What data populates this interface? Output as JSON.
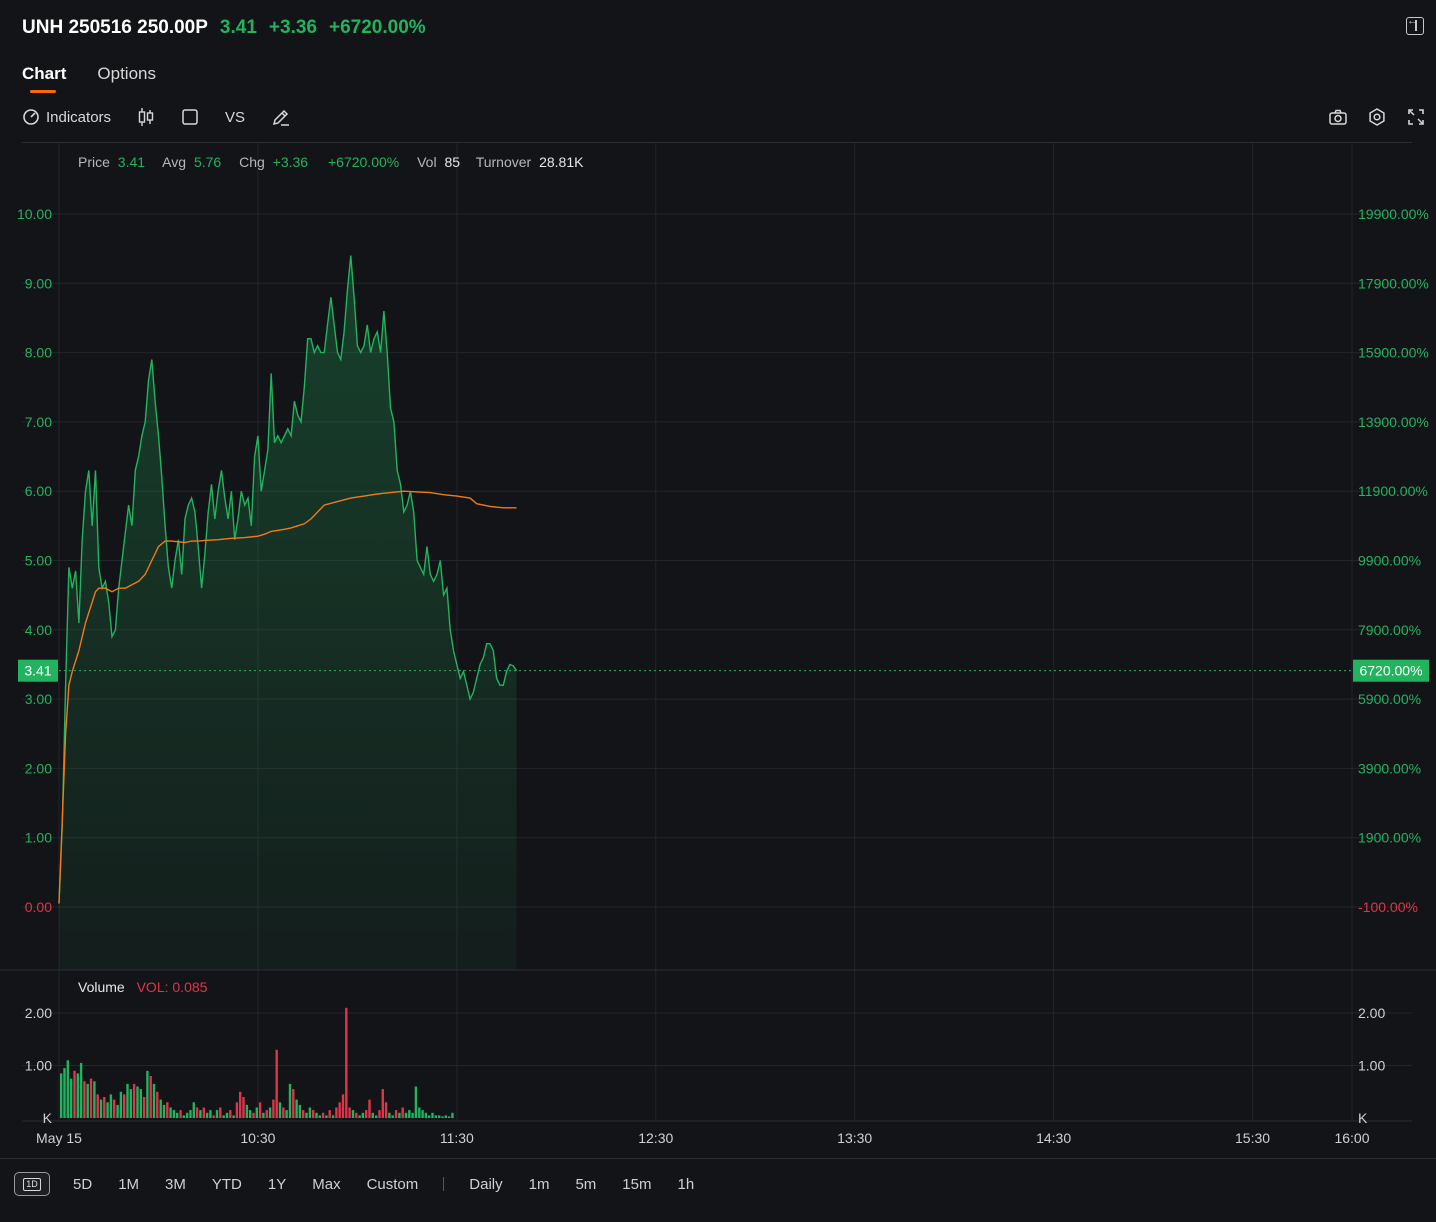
{
  "header": {
    "symbol": "UNH 250516 250.00P",
    "price": "3.41",
    "change": "+3.36",
    "change_pct": "+6720.00%"
  },
  "tabs": [
    {
      "label": "Chart",
      "active": true
    },
    {
      "label": "Options",
      "active": false
    }
  ],
  "toolbar": {
    "indicators_label": "Indicators",
    "vs_label": "VS"
  },
  "info_bar": {
    "price_label": "Price",
    "price_value": "3.41",
    "avg_label": "Avg",
    "avg_value": "5.76",
    "chg_label": "Chg",
    "chg_value": "+3.36",
    "chg_pct_value": "+6720.00%",
    "vol_label": "Vol",
    "vol_value": "85",
    "turnover_label": "Turnover",
    "turnover_value": "28.81K"
  },
  "volume_legend": {
    "label": "Volume",
    "value": "VOL: 0.085"
  },
  "periods": {
    "day": "1D",
    "ranges": [
      "5D",
      "1M",
      "3M",
      "YTD",
      "1Y",
      "Max",
      "Custom"
    ],
    "intervals": [
      "Daily",
      "1m",
      "5m",
      "15m",
      "1h"
    ]
  },
  "colors": {
    "up": "#22b35e",
    "down": "#e0344a",
    "avg_line": "#f07a1a",
    "background": "#131418"
  },
  "chart_data": {
    "type": "line",
    "x_ticks": [
      "May 15",
      "10:30",
      "11:30",
      "12:30",
      "13:30",
      "14:30",
      "15:30",
      "16:00"
    ],
    "x_tick_minutes": [
      0,
      60,
      120,
      180,
      240,
      300,
      360,
      390
    ],
    "xlim": [
      0,
      390
    ],
    "ylim": [
      0,
      10
    ],
    "y_ticks": [
      "10.00",
      "9.00",
      "8.00",
      "7.00",
      "6.00",
      "5.00",
      "4.00",
      "3.00",
      "2.00",
      "1.00",
      "0.00"
    ],
    "y_right_ticks": [
      "19900.00%",
      "17900.00%",
      "15900.00%",
      "13900.00%",
      "11900.00%",
      "9900.00%",
      "7900.00%",
      "5900.00%",
      "3900.00%",
      "1900.00%",
      "-100.00%"
    ],
    "last_price_label": "3.41",
    "last_pct_label": "6720.00%",
    "last_price": 3.41,
    "grid": true,
    "series": [
      {
        "values": [
          [
            0,
            0.05
          ],
          [
            1,
            1.2
          ],
          [
            2,
            3.2
          ],
          [
            3,
            4.9
          ],
          [
            4,
            4.6
          ],
          [
            5,
            4.85
          ],
          [
            6,
            4.1
          ],
          [
            7,
            5.3
          ],
          [
            8,
            6.0
          ],
          [
            9,
            6.3
          ],
          [
            10,
            5.5
          ],
          [
            11,
            6.3
          ],
          [
            12,
            4.9
          ],
          [
            13,
            4.6
          ],
          [
            14,
            4.7
          ],
          [
            15,
            4.4
          ],
          [
            16,
            3.9
          ],
          [
            17,
            4.0
          ],
          [
            18,
            4.6
          ],
          [
            19,
            5.0
          ],
          [
            20,
            5.4
          ],
          [
            21,
            5.8
          ],
          [
            22,
            5.5
          ],
          [
            23,
            6.3
          ],
          [
            24,
            6.5
          ],
          [
            25,
            6.8
          ],
          [
            26,
            7.0
          ],
          [
            27,
            7.6
          ],
          [
            28,
            7.9
          ],
          [
            29,
            7.3
          ],
          [
            30,
            6.8
          ],
          [
            31,
            6.2
          ],
          [
            32,
            5.5
          ],
          [
            33,
            4.9
          ],
          [
            34,
            4.6
          ],
          [
            35,
            5.0
          ],
          [
            36,
            5.3
          ],
          [
            37,
            4.8
          ],
          [
            38,
            5.6
          ],
          [
            39,
            5.8
          ],
          [
            40,
            5.9
          ],
          [
            41,
            5.7
          ],
          [
            42,
            5.2
          ],
          [
            43,
            4.6
          ],
          [
            44,
            5.1
          ],
          [
            45,
            5.7
          ],
          [
            46,
            6.1
          ],
          [
            47,
            5.6
          ],
          [
            48,
            6.0
          ],
          [
            49,
            6.3
          ],
          [
            50,
            5.9
          ],
          [
            51,
            5.6
          ],
          [
            52,
            6.0
          ],
          [
            53,
            5.3
          ],
          [
            54,
            5.6
          ],
          [
            55,
            6.0
          ],
          [
            56,
            5.8
          ],
          [
            57,
            5.9
          ],
          [
            58,
            5.5
          ],
          [
            59,
            6.5
          ],
          [
            60,
            6.8
          ],
          [
            61,
            6.0
          ],
          [
            62,
            6.3
          ],
          [
            63,
            6.6
          ],
          [
            64,
            7.7
          ],
          [
            65,
            6.7
          ],
          [
            66,
            6.8
          ],
          [
            67,
            6.7
          ],
          [
            68,
            6.8
          ],
          [
            69,
            6.9
          ],
          [
            70,
            6.8
          ],
          [
            71,
            7.3
          ],
          [
            72,
            7.1
          ],
          [
            73,
            7.0
          ],
          [
            74,
            7.5
          ],
          [
            75,
            8.2
          ],
          [
            76,
            8.2
          ],
          [
            77,
            8.0
          ],
          [
            78,
            8.1
          ],
          [
            79,
            8.0
          ],
          [
            80,
            8.0
          ],
          [
            81,
            8.4
          ],
          [
            82,
            8.8
          ],
          [
            83,
            8.4
          ],
          [
            84,
            8.0
          ],
          [
            85,
            7.9
          ],
          [
            86,
            8.3
          ],
          [
            87,
            8.9
          ],
          [
            88,
            9.4
          ],
          [
            89,
            8.8
          ],
          [
            90,
            8.1
          ],
          [
            91,
            8.0
          ],
          [
            92,
            8.1
          ],
          [
            93,
            8.4
          ],
          [
            94,
            8.0
          ],
          [
            95,
            8.2
          ],
          [
            96,
            8.3
          ],
          [
            97,
            8.0
          ],
          [
            98,
            8.6
          ],
          [
            99,
            8.0
          ],
          [
            100,
            7.2
          ],
          [
            101,
            7.0
          ],
          [
            102,
            6.3
          ],
          [
            103,
            6.1
          ],
          [
            104,
            5.7
          ],
          [
            105,
            5.8
          ],
          [
            106,
            6.0
          ],
          [
            107,
            5.7
          ],
          [
            108,
            5.0
          ],
          [
            109,
            4.9
          ],
          [
            110,
            4.8
          ],
          [
            111,
            5.2
          ],
          [
            112,
            4.8
          ],
          [
            113,
            4.7
          ],
          [
            114,
            4.8
          ],
          [
            115,
            5.0
          ],
          [
            116,
            4.5
          ],
          [
            117,
            4.6
          ],
          [
            118,
            4.0
          ],
          [
            119,
            3.7
          ],
          [
            120,
            3.5
          ],
          [
            121,
            3.3
          ],
          [
            122,
            3.4
          ],
          [
            123,
            3.2
          ],
          [
            124,
            3.0
          ],
          [
            125,
            3.1
          ],
          [
            126,
            3.3
          ],
          [
            127,
            3.5
          ],
          [
            128,
            3.6
          ],
          [
            129,
            3.8
          ],
          [
            130,
            3.8
          ],
          [
            131,
            3.7
          ],
          [
            132,
            3.3
          ],
          [
            133,
            3.2
          ],
          [
            134,
            3.2
          ],
          [
            135,
            3.4
          ],
          [
            136,
            3.5
          ],
          [
            137,
            3.48
          ],
          [
            138,
            3.41
          ]
        ]
      },
      {
        "values": [
          [
            0,
            0.05
          ],
          [
            2,
            2.5
          ],
          [
            3,
            3.2
          ],
          [
            4,
            3.4
          ],
          [
            6,
            3.7
          ],
          [
            8,
            4.1
          ],
          [
            10,
            4.4
          ],
          [
            11,
            4.55
          ],
          [
            12,
            4.6
          ],
          [
            14,
            4.6
          ],
          [
            16,
            4.55
          ],
          [
            18,
            4.6
          ],
          [
            20,
            4.6
          ],
          [
            22,
            4.65
          ],
          [
            24,
            4.7
          ],
          [
            26,
            4.8
          ],
          [
            28,
            5.0
          ],
          [
            30,
            5.2
          ],
          [
            32,
            5.28
          ],
          [
            34,
            5.28
          ],
          [
            36,
            5.27
          ],
          [
            38,
            5.26
          ],
          [
            40,
            5.28
          ],
          [
            42,
            5.28
          ],
          [
            44,
            5.29
          ],
          [
            48,
            5.3
          ],
          [
            52,
            5.32
          ],
          [
            56,
            5.33
          ],
          [
            60,
            5.35
          ],
          [
            62,
            5.38
          ],
          [
            64,
            5.42
          ],
          [
            68,
            5.45
          ],
          [
            70,
            5.47
          ],
          [
            72,
            5.5
          ],
          [
            74,
            5.53
          ],
          [
            76,
            5.6
          ],
          [
            78,
            5.7
          ],
          [
            80,
            5.8
          ],
          [
            84,
            5.85
          ],
          [
            88,
            5.9
          ],
          [
            92,
            5.93
          ],
          [
            96,
            5.96
          ],
          [
            100,
            5.98
          ],
          [
            104,
            6.0
          ],
          [
            108,
            5.99
          ],
          [
            112,
            5.98
          ],
          [
            116,
            5.95
          ],
          [
            120,
            5.93
          ],
          [
            124,
            5.9
          ],
          [
            126,
            5.82
          ],
          [
            130,
            5.78
          ],
          [
            134,
            5.76
          ],
          [
            138,
            5.76
          ]
        ]
      }
    ]
  },
  "volume_chart": {
    "type": "bar",
    "y_ticks": [
      "2.00",
      "1.00",
      "K"
    ],
    "y_right_ticks": [
      "2.00",
      "1.00",
      "K"
    ],
    "ylim": [
      0,
      2.2
    ],
    "bars": [
      [
        0.85,
        "up"
      ],
      [
        0.95,
        "up"
      ],
      [
        1.1,
        "up"
      ],
      [
        0.75,
        "up"
      ],
      [
        0.9,
        "down"
      ],
      [
        0.85,
        "up"
      ],
      [
        1.05,
        "up"
      ],
      [
        0.7,
        "down"
      ],
      [
        0.65,
        "up"
      ],
      [
        0.75,
        "down"
      ],
      [
        0.7,
        "up"
      ],
      [
        0.45,
        "down"
      ],
      [
        0.35,
        "up"
      ],
      [
        0.4,
        "down"
      ],
      [
        0.3,
        "up"
      ],
      [
        0.45,
        "up"
      ],
      [
        0.35,
        "down"
      ],
      [
        0.25,
        "up"
      ],
      [
        0.5,
        "up"
      ],
      [
        0.45,
        "down"
      ],
      [
        0.65,
        "up"
      ],
      [
        0.55,
        "up"
      ],
      [
        0.65,
        "down"
      ],
      [
        0.6,
        "up"
      ],
      [
        0.55,
        "up"
      ],
      [
        0.4,
        "down"
      ],
      [
        0.9,
        "up"
      ],
      [
        0.8,
        "down"
      ],
      [
        0.65,
        "up"
      ],
      [
        0.5,
        "down"
      ],
      [
        0.35,
        "up"
      ],
      [
        0.25,
        "up"
      ],
      [
        0.3,
        "down"
      ],
      [
        0.2,
        "up"
      ],
      [
        0.15,
        "up"
      ],
      [
        0.1,
        "up"
      ],
      [
        0.15,
        "down"
      ],
      [
        0.05,
        "up"
      ],
      [
        0.1,
        "up"
      ],
      [
        0.15,
        "up"
      ],
      [
        0.3,
        "up"
      ],
      [
        0.2,
        "down"
      ],
      [
        0.15,
        "up"
      ],
      [
        0.2,
        "down"
      ],
      [
        0.1,
        "up"
      ],
      [
        0.15,
        "up"
      ],
      [
        0.05,
        "down"
      ],
      [
        0.15,
        "up"
      ],
      [
        0.2,
        "down"
      ],
      [
        0.05,
        "up"
      ],
      [
        0.1,
        "up"
      ],
      [
        0.15,
        "down"
      ],
      [
        0.05,
        "up"
      ],
      [
        0.3,
        "down"
      ],
      [
        0.5,
        "down"
      ],
      [
        0.4,
        "down"
      ],
      [
        0.25,
        "up"
      ],
      [
        0.15,
        "up"
      ],
      [
        0.1,
        "down"
      ],
      [
        0.2,
        "up"
      ],
      [
        0.3,
        "down"
      ],
      [
        0.1,
        "up"
      ],
      [
        0.15,
        "down"
      ],
      [
        0.2,
        "up"
      ],
      [
        0.35,
        "down"
      ],
      [
        1.3,
        "down"
      ],
      [
        0.3,
        "up"
      ],
      [
        0.2,
        "down"
      ],
      [
        0.15,
        "up"
      ],
      [
        0.65,
        "up"
      ],
      [
        0.55,
        "down"
      ],
      [
        0.35,
        "up"
      ],
      [
        0.25,
        "up"
      ],
      [
        0.15,
        "down"
      ],
      [
        0.1,
        "up"
      ],
      [
        0.2,
        "up"
      ],
      [
        0.15,
        "down"
      ],
      [
        0.1,
        "up"
      ],
      [
        0.05,
        "up"
      ],
      [
        0.1,
        "down"
      ],
      [
        0.05,
        "up"
      ],
      [
        0.15,
        "down"
      ],
      [
        0.05,
        "up"
      ],
      [
        0.2,
        "down"
      ],
      [
        0.3,
        "down"
      ],
      [
        0.45,
        "down"
      ],
      [
        2.1,
        "down"
      ],
      [
        0.2,
        "down"
      ],
      [
        0.15,
        "up"
      ],
      [
        0.1,
        "down"
      ],
      [
        0.05,
        "up"
      ],
      [
        0.1,
        "up"
      ],
      [
        0.15,
        "down"
      ],
      [
        0.35,
        "down"
      ],
      [
        0.1,
        "up"
      ],
      [
        0.05,
        "up"
      ],
      [
        0.15,
        "down"
      ],
      [
        0.55,
        "down"
      ],
      [
        0.3,
        "down"
      ],
      [
        0.1,
        "up"
      ],
      [
        0.05,
        "up"
      ],
      [
        0.15,
        "down"
      ],
      [
        0.1,
        "up"
      ],
      [
        0.2,
        "down"
      ],
      [
        0.1,
        "up"
      ],
      [
        0.15,
        "up"
      ],
      [
        0.1,
        "up"
      ],
      [
        0.6,
        "up"
      ],
      [
        0.2,
        "up"
      ],
      [
        0.15,
        "up"
      ],
      [
        0.1,
        "up"
      ],
      [
        0.05,
        "up"
      ],
      [
        0.1,
        "up"
      ],
      [
        0.05,
        "up"
      ],
      [
        0.05,
        "up"
      ],
      [
        0.03,
        "up"
      ],
      [
        0.05,
        "up"
      ],
      [
        0.03,
        "up"
      ],
      [
        0.1,
        "up"
      ]
    ]
  }
}
